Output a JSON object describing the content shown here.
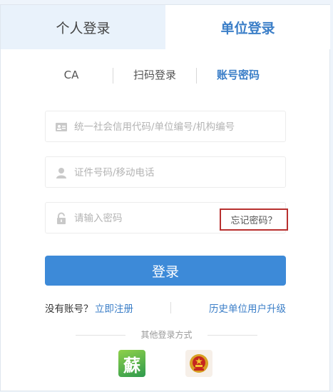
{
  "tabs": {
    "personal": "个人登录",
    "unit": "单位登录"
  },
  "methods": {
    "ca": "CA",
    "scan": "扫码登录",
    "password": "账号密码"
  },
  "form": {
    "credit_code_placeholder": "统一社会信用代码/单位编号/机构编号",
    "id_placeholder": "证件号码/移动电话",
    "password_placeholder": "请输入密码",
    "forgot_label": "忘记密码？",
    "login_label": "登录"
  },
  "register": {
    "no_account": "没有账号？",
    "register_now": "立即注册",
    "upgrade": "历史单位用户升级"
  },
  "other_login": {
    "label": "其他登录方式",
    "jiangsu_glyph": "蘇",
    "icons": [
      "jiangsu-app-icon",
      "national-emblem-icon"
    ]
  },
  "colors": {
    "accent": "#3c7fc8",
    "button": "#3d8ad8",
    "highlight_border": "#b8302f"
  }
}
